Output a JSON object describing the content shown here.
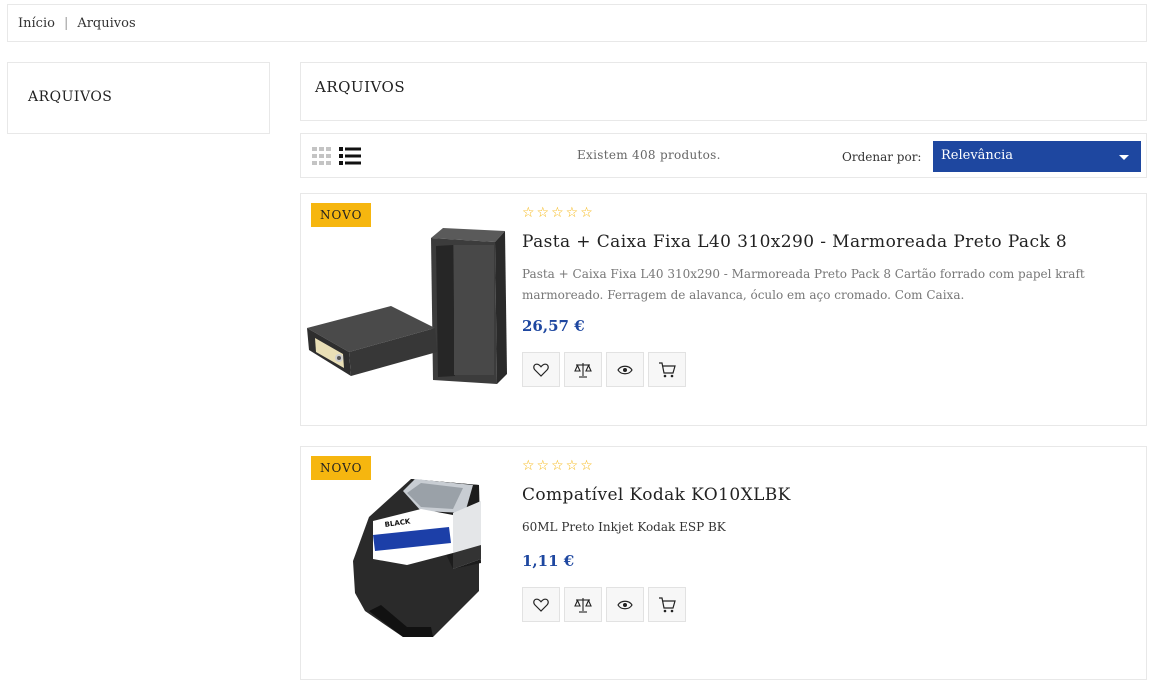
{
  "breadcrumb": {
    "home": "Início",
    "separator": "|",
    "current": "Arquivos"
  },
  "sidebar": {
    "title": "ARQUIVOS"
  },
  "category": {
    "title": "ARQUIVOS"
  },
  "toolbar": {
    "count_text": "Existem 408 produtos.",
    "sort_label": "Ordenar por:",
    "sort_value": "Relevância",
    "views": [
      "grid-view-icon",
      "list-view-icon"
    ]
  },
  "colors": {
    "accent": "#1e47a0",
    "badge": "#f6b60f",
    "border": "#e8e8e8"
  },
  "products": [
    {
      "badge": "NOVO",
      "stars": "☆☆☆☆☆",
      "rating": 0,
      "title": "Pasta + Caixa Fixa L40 310x290 - Marmoreada Preto Pack 8",
      "description": "Pasta + Caixa Fixa L40 310x290 - Marmoreada Preto Pack 8 Cartão forrado com papel kraft marmoreado. Ferragem de alavanca, óculo em aço cromado. Com Caixa.",
      "price": "26,57 €",
      "actions": [
        "heart-icon",
        "compare-icon",
        "eye-icon",
        "cart-icon"
      ]
    },
    {
      "badge": "NOVO",
      "stars": "☆☆☆☆☆",
      "rating": 0,
      "title": "Compatível Kodak KO10XLBK",
      "description": "60ML Preto Inkjet Kodak ESP BK",
      "price": "1,11 €",
      "actions": [
        "heart-icon",
        "compare-icon",
        "eye-icon",
        "cart-icon"
      ]
    }
  ]
}
